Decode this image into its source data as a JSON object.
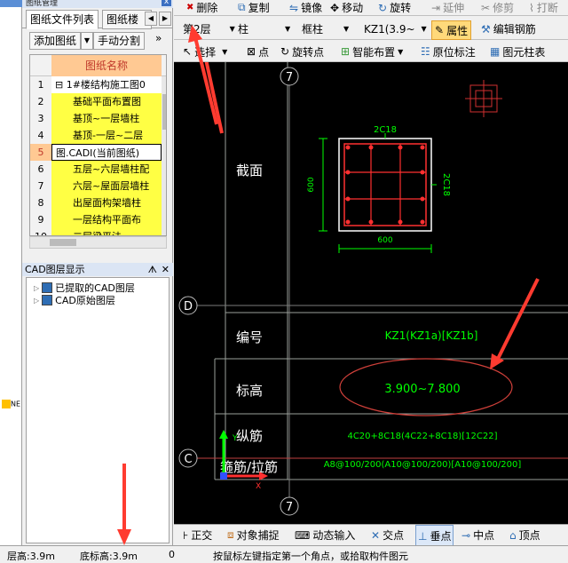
{
  "window": {
    "panel_title": "图纸管理",
    "close_glyph": "x"
  },
  "panel": {
    "tabs": [
      "图纸文件列表",
      "图纸楼"
    ],
    "add_button": "添加图纸",
    "split_button": "手动分割",
    "more_glyph": "»",
    "grid_header": "图纸名称",
    "rows": [
      {
        "n": "1",
        "text": "⊟ 1#楼结构施工图0"
      },
      {
        "n": "2",
        "text": "基础平面布置图"
      },
      {
        "n": "3",
        "text": "基顶~一层墙柱"
      },
      {
        "n": "4",
        "text": "基顶-一层~二层"
      },
      {
        "n": "5",
        "text": "图.CADI(当前图纸)"
      },
      {
        "n": "6",
        "text": "五层~六层墙柱配"
      },
      {
        "n": "7",
        "text": "六层~屋面层墙柱"
      },
      {
        "n": "8",
        "text": "出屋面构架墙柱"
      },
      {
        "n": "9",
        "text": "一层结构平面布"
      },
      {
        "n": "10",
        "text": "二层梁平法"
      }
    ],
    "current_row_index": 4,
    "layers_title": "CAD图层显示",
    "tree": [
      "已提取的CAD图层",
      "CAD原始图层"
    ]
  },
  "toolbar1": [
    "删除",
    "复制",
    "镜像",
    "移动",
    "旋转",
    "延伸",
    "修剪",
    "打断"
  ],
  "toolbar2": {
    "floor": "第2层",
    "type": "柱",
    "subtype": "框柱",
    "element": "KZ1(3.9~",
    "props": "属性",
    "edit": "编辑钢筋"
  },
  "toolbar3": [
    "选择",
    "点",
    "旋转点",
    "智能布置",
    "原位标注",
    "图元柱表"
  ],
  "drawing": {
    "grid_7_top": "7",
    "grid_7_bottom": "7",
    "grid_d": "D",
    "grid_c": "C",
    "section_label": "截面",
    "code_label": "编号",
    "elev_label": "标高",
    "long_label": "纵筋",
    "stirrup_label": "箍筋/拉筋",
    "top_rebar": "2C18",
    "side_rebar": "2C18",
    "dim_vertical": "600",
    "dim_horizontal": "600",
    "code_value": "KZ1(KZ1a)[KZ1b]",
    "elev_value": "3.900~7.800",
    "long_value": "4C20+8C18(4C22+8C18)[12C22]",
    "stirrup_value": "A8@100/200(A10@100/200)[A10@100/200]",
    "axis_x": "X",
    "axis_y": "Y"
  },
  "bottombar": [
    "正交",
    "对象捕捉",
    "动态输入",
    "交点",
    "垂点",
    "中点",
    "顶点"
  ],
  "status": {
    "floor_height": "层高:3.9m",
    "base_elev": "底标高:3.9m",
    "zero": "0",
    "hint": "按鼠标左键指定第一个角点，或拾取构件图元"
  },
  "colors": {
    "canvas": "#000000",
    "cad_green": "#00ff00",
    "label_white": "#ffffff",
    "arrow_red": "#ff3b30",
    "ellipse": "#d0403a"
  }
}
